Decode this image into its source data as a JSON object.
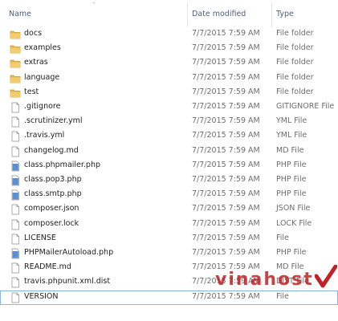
{
  "header": {
    "name": "Name",
    "date_modified": "Date modified",
    "type": "Type"
  },
  "files": [
    {
      "name": "docs",
      "date": "7/7/2015 7:59 AM",
      "type": "File folder",
      "icon": "folder-icon"
    },
    {
      "name": "examples",
      "date": "7/7/2015 7:59 AM",
      "type": "File folder",
      "icon": "folder-icon"
    },
    {
      "name": "extras",
      "date": "7/7/2015 7:59 AM",
      "type": "File folder",
      "icon": "folder-icon"
    },
    {
      "name": "language",
      "date": "7/7/2015 7:59 AM",
      "type": "File folder",
      "icon": "folder-icon"
    },
    {
      "name": "test",
      "date": "7/7/2015 7:59 AM",
      "type": "File folder",
      "icon": "folder-icon"
    },
    {
      "name": ".gitignore",
      "date": "7/7/2015 7:59 AM",
      "type": "GITIGNORE File",
      "icon": "file-icon"
    },
    {
      "name": ".scrutinizer.yml",
      "date": "7/7/2015 7:59 AM",
      "type": "YML File",
      "icon": "file-icon"
    },
    {
      "name": ".travis.yml",
      "date": "7/7/2015 7:59 AM",
      "type": "YML File",
      "icon": "file-icon"
    },
    {
      "name": "changelog.md",
      "date": "7/7/2015 7:59 AM",
      "type": "MD File",
      "icon": "file-icon"
    },
    {
      "name": "class.phpmailer.php",
      "date": "7/7/2015 7:59 AM",
      "type": "PHP File",
      "icon": "php-file-icon"
    },
    {
      "name": "class.pop3.php",
      "date": "7/7/2015 7:59 AM",
      "type": "PHP File",
      "icon": "php-file-icon"
    },
    {
      "name": "class.smtp.php",
      "date": "7/7/2015 7:59 AM",
      "type": "PHP File",
      "icon": "php-file-icon"
    },
    {
      "name": "composer.json",
      "date": "7/7/2015 7:59 AM",
      "type": "JSON File",
      "icon": "file-icon"
    },
    {
      "name": "composer.lock",
      "date": "7/7/2015 7:59 AM",
      "type": "LOCK File",
      "icon": "file-icon"
    },
    {
      "name": "LICENSE",
      "date": "7/7/2015 7:59 AM",
      "type": "File",
      "icon": "file-icon"
    },
    {
      "name": "PHPMailerAutoload.php",
      "date": "7/7/2015 7:59 AM",
      "type": "PHP File",
      "icon": "php-file-icon"
    },
    {
      "name": "README.md",
      "date": "7/7/2015 7:59 AM",
      "type": "MD File",
      "icon": "file-icon"
    },
    {
      "name": "travis.phpunit.xml.dist",
      "date": "7/7/2015 7:59 AM",
      "type": "DIST File",
      "icon": "file-icon"
    },
    {
      "name": "VERSION",
      "date": "7/7/2015 7:59 AM",
      "type": "File",
      "icon": "file-icon",
      "selected": true
    }
  ],
  "watermark": "vinahost",
  "colors": {
    "folder": "#e8b84a",
    "php_file": "#5b8fd1",
    "selection_border": "#8db2e3",
    "header_text": "#4c607a",
    "watermark": "#c02226"
  }
}
